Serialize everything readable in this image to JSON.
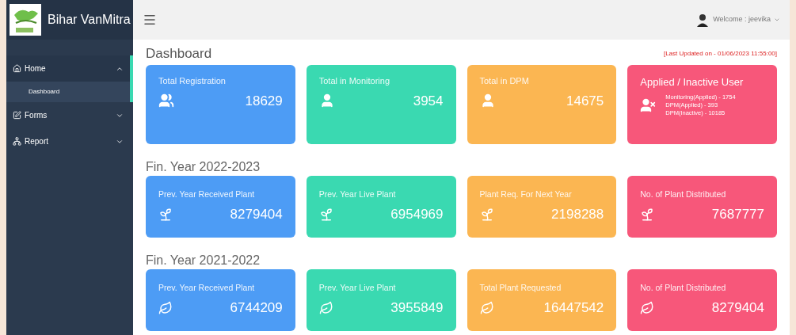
{
  "brand": {
    "name": "Bihar VanMitra"
  },
  "header": {
    "welcome": "Welcome : jeevika"
  },
  "sidebar": {
    "items": [
      {
        "label": "Home",
        "expanded": true,
        "children": [
          {
            "label": "Dashboard",
            "selected": true
          }
        ]
      },
      {
        "label": "Forms",
        "expanded": false
      },
      {
        "label": "Report",
        "expanded": false
      }
    ]
  },
  "page": {
    "title": "Dashboard",
    "last_updated": "[Last Updated on - 01/06/2023 11:55:00]"
  },
  "summary_cards": [
    {
      "kind": "count",
      "title": "Total Registration",
      "value": "18629",
      "color": "#4d9cf5"
    },
    {
      "kind": "count",
      "title": "Total in Monitoring",
      "value": "3954",
      "color": "#3ad9b1"
    },
    {
      "kind": "count",
      "title": "Total in DPM",
      "value": "14675",
      "color": "#fbb652"
    },
    {
      "kind": "list",
      "title": "Applied / Inactive User",
      "lines": [
        "Monitoring(Applied) - 1754",
        "DPM(Applied) - 393",
        "DPM(Inactive) - 10185"
      ],
      "color": "#f7577a"
    }
  ],
  "sections": [
    {
      "title": "Fin. Year 2022-2023",
      "cards": [
        {
          "title": "Prev. Year Received Plant",
          "value": "8279404",
          "color": "#4d9cf5"
        },
        {
          "title": "Prev. Year Live Plant",
          "value": "6954969",
          "color": "#3ad9b1"
        },
        {
          "title": "Plant Req. For Next Year",
          "value": "2198288",
          "color": "#fbb652"
        },
        {
          "title": "No. of Plant Distributed",
          "value": "7687777",
          "color": "#f7577a"
        }
      ]
    },
    {
      "title": "Fin. Year 2021-2022",
      "cards": [
        {
          "title": "Prev. Year Received Plant",
          "value": "6744209",
          "color": "#4d9cf5"
        },
        {
          "title": "Prev. Year Live Plant",
          "value": "3955849",
          "color": "#3ad9b1"
        },
        {
          "title": "Total Plant Requested",
          "value": "16447542",
          "color": "#fbb652"
        },
        {
          "title": "No. of Plant Distributed",
          "value": "8279404",
          "color": "#f7577a"
        }
      ]
    }
  ]
}
